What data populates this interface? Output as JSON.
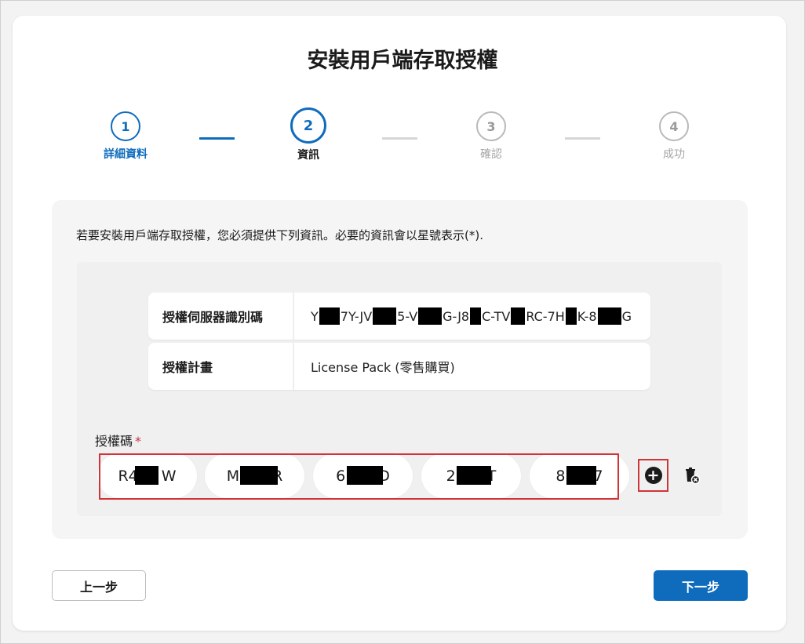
{
  "dialog": {
    "title": "安裝用戶端存取授權"
  },
  "stepper": {
    "steps": [
      {
        "number": "1",
        "label": "詳細資料",
        "state": "done"
      },
      {
        "number": "2",
        "label": "資訊",
        "state": "current"
      },
      {
        "number": "3",
        "label": "確認",
        "state": "pending"
      },
      {
        "number": "4",
        "label": "成功",
        "state": "pending"
      }
    ]
  },
  "intro_text": "若要安裝用戶端存取授權，您必須提供下列資訊。必要的資訊會以星號表示(*).",
  "info_table": {
    "rows": [
      {
        "key": "授權伺服器識別碼",
        "value_parts": [
          "Y",
          "7Y-JV",
          "5-V",
          "G-J8",
          "C-TV",
          "RC-7H",
          "K-8",
          "G"
        ]
      },
      {
        "key": "授權計畫",
        "value": "License Pack (零售購買)"
      }
    ]
  },
  "license_code": {
    "label": "授權碼",
    "required_marker": "*",
    "segments": [
      {
        "visible_start": "R4",
        "visible_end": "W"
      },
      {
        "visible_start": "M",
        "visible_end": "R"
      },
      {
        "visible_start": "6",
        "visible_end": "D"
      },
      {
        "visible_start": "2",
        "visible_end": "T"
      },
      {
        "visible_start": "8",
        "visible_end": "7"
      }
    ],
    "add_icon": "plus-circle-icon",
    "delete_icon": "trash-clear-icon"
  },
  "footer": {
    "back_label": "上一步",
    "next_label": "下一步"
  },
  "colors": {
    "accent": "#0f6cbd",
    "highlight": "#d13438",
    "required": "#c4314b"
  }
}
